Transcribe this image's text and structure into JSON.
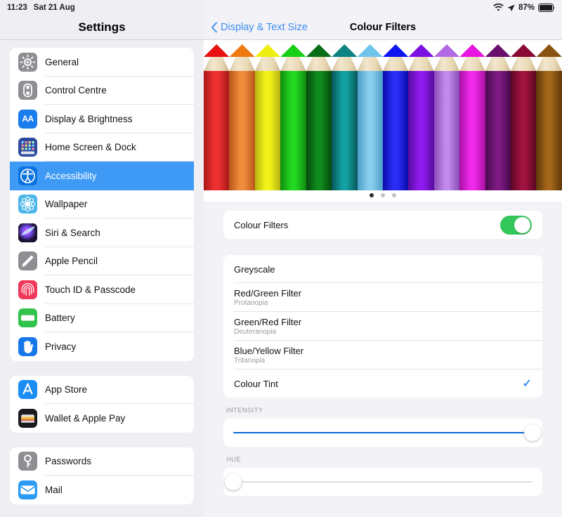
{
  "status_bar": {
    "time": "11:23",
    "date": "Sat 21 Aug",
    "battery_percent": "87%",
    "wifi_icon": "wifi-icon",
    "location_icon": "location-arrow-icon",
    "battery_icon": "battery-icon"
  },
  "sidebar": {
    "title": "Settings",
    "groups": [
      {
        "items": [
          {
            "label": "General",
            "icon": "gear-icon",
            "icon_class": "ic-gear",
            "glyph": "gear",
            "selected": false
          },
          {
            "label": "Control Centre",
            "icon": "toggles-icon",
            "icon_class": "ic-cc",
            "glyph": "cc",
            "selected": false
          },
          {
            "label": "Display & Brightness",
            "icon": "aa-text-icon",
            "icon_class": "ic-aa",
            "glyph": "aa",
            "selected": false
          },
          {
            "label": "Home Screen & Dock",
            "icon": "app-grid-icon",
            "icon_class": "ic-hs",
            "glyph": "grid",
            "selected": false
          },
          {
            "label": "Accessibility",
            "icon": "accessibility-person-icon",
            "icon_class": "ic-acc",
            "glyph": "acc",
            "selected": true
          },
          {
            "label": "Wallpaper",
            "icon": "flower-icon",
            "icon_class": "ic-wall",
            "glyph": "flower",
            "selected": false
          },
          {
            "label": "Siri & Search",
            "icon": "siri-orb-icon",
            "icon_class": "ic-siri",
            "glyph": "siri",
            "selected": false
          },
          {
            "label": "Apple Pencil",
            "icon": "pencil-icon",
            "icon_class": "ic-pen",
            "glyph": "pencil",
            "selected": false
          },
          {
            "label": "Touch ID & Passcode",
            "icon": "fingerprint-icon",
            "icon_class": "ic-tid",
            "glyph": "finger",
            "selected": false
          },
          {
            "label": "Battery",
            "icon": "battery-icon",
            "icon_class": "ic-batt",
            "glyph": "battery",
            "selected": false
          },
          {
            "label": "Privacy",
            "icon": "hand-icon",
            "icon_class": "ic-priv",
            "glyph": "hand",
            "selected": false
          }
        ]
      },
      {
        "items": [
          {
            "label": "App Store",
            "icon": "app-store-icon",
            "icon_class": "ic-apps",
            "glyph": "appstore",
            "selected": false
          },
          {
            "label": "Wallet & Apple Pay",
            "icon": "wallet-icon",
            "icon_class": "ic-wallet",
            "glyph": "wallet",
            "selected": false
          }
        ]
      },
      {
        "items": [
          {
            "label": "Passwords",
            "icon": "key-icon",
            "icon_class": "ic-pass",
            "glyph": "key",
            "selected": false
          },
          {
            "label": "Mail",
            "icon": "envelope-icon",
            "icon_class": "ic-mail",
            "glyph": "mail",
            "selected": false
          }
        ]
      }
    ]
  },
  "detail": {
    "back_label": "Display & Text Size",
    "back_icon": "chevron-left-icon",
    "title": "Colour Filters",
    "banner": {
      "name": "colour-pencils-preview",
      "pencils": [
        {
          "lead": "#e81010",
          "barrel_mid": "#ef3030",
          "barrel_edge": "#a81818"
        },
        {
          "lead": "#ef7a12",
          "barrel_mid": "#ef8c3c",
          "barrel_edge": "#b8561a"
        },
        {
          "lead": "#eeee10",
          "barrel_mid": "#f2f21a",
          "barrel_edge": "#b5b510"
        },
        {
          "lead": "#16cf16",
          "barrel_mid": "#22d822",
          "barrel_edge": "#0f8a0f"
        },
        {
          "lead": "#0a6e16",
          "barrel_mid": "#0f8a1c",
          "barrel_edge": "#064a0e"
        },
        {
          "lead": "#0c8283",
          "barrel_mid": "#13a0a1",
          "barrel_edge": "#075657"
        },
        {
          "lead": "#6ec4ea",
          "barrel_mid": "#86cdee",
          "barrel_edge": "#4a9ec6"
        },
        {
          "lead": "#1016f0",
          "barrel_mid": "#2a2ef6",
          "barrel_edge": "#0a0ca8"
        },
        {
          "lead": "#7c10e0",
          "barrel_mid": "#8f1aee",
          "barrel_edge": "#560c9e"
        },
        {
          "lead": "#b26ae4",
          "barrel_mid": "#c189ea",
          "barrel_edge": "#8a4cb8"
        },
        {
          "lead": "#e814e0",
          "barrel_mid": "#f02aea",
          "barrel_edge": "#a80ea2"
        },
        {
          "lead": "#69106e",
          "barrel_mid": "#7c1a82",
          "barrel_edge": "#48094c"
        },
        {
          "lead": "#8a0a34",
          "barrel_mid": "#a01240",
          "barrel_edge": "#5c0622"
        },
        {
          "lead": "#8a5210",
          "barrel_mid": "#a4661a",
          "barrel_edge": "#5e380a"
        }
      ],
      "page_dots": {
        "count": 3,
        "active_index": 0
      }
    },
    "master_toggle": {
      "label": "Colour Filters",
      "on": true,
      "on_color": "#34c759"
    },
    "filters": [
      {
        "label": "Greyscale",
        "sub": "",
        "selected": false
      },
      {
        "label": "Red/Green Filter",
        "sub": "Protanopia",
        "selected": false
      },
      {
        "label": "Green/Red Filter",
        "sub": "Deuteranopia",
        "selected": false
      },
      {
        "label": "Blue/Yellow Filter",
        "sub": "Tritanopia",
        "selected": false
      },
      {
        "label": "Colour Tint",
        "sub": "",
        "selected": true
      }
    ],
    "checkmark_glyph": "✓",
    "checkmark_color": "#3e8ef0",
    "sliders": [
      {
        "label": "INTENSITY",
        "value": 100,
        "fill_color": "#0b66d8",
        "name": "intensity-slider"
      },
      {
        "label": "HUE",
        "value": 0,
        "fill_color": "#0b66d8",
        "name": "hue-slider"
      }
    ]
  }
}
